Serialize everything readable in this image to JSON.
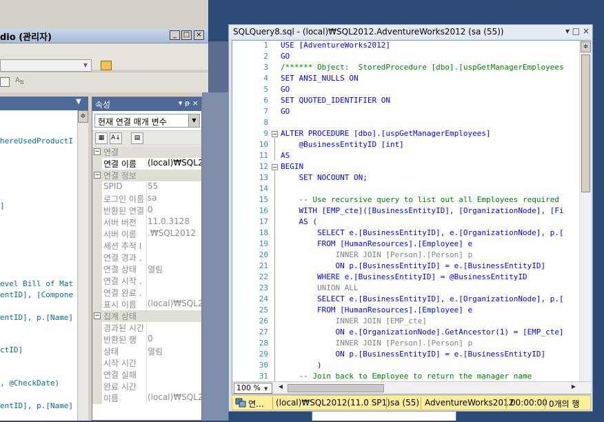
{
  "background_window": {
    "title": "dio (관리자)",
    "controls": [
      "_",
      "□",
      "×"
    ]
  },
  "left_editor_fragments": [
    "hereUsedProductI",
    "]",
    "evel Bill of Mat",
    "entID], [Compone",
    "entID], p.[Name]",
    "ctID]",
    ", @CheckDate)",
    "entID], p.[Name]"
  ],
  "properties": {
    "title": "속성",
    "title_controls": "▾ ᵽ ×",
    "selector_value": "현재 연결 매개 변수",
    "categories": [
      {
        "name": "연결",
        "rows": [
          {
            "name": "연결 이름",
            "value": "(local)₩SQL2",
            "selected": true
          }
        ]
      },
      {
        "name": "연결 정보",
        "rows": [
          {
            "name": "SPID",
            "value": "55"
          },
          {
            "name": "로그인 이름",
            "value": "sa"
          },
          {
            "name": "반환된 연결",
            "value": "0"
          },
          {
            "name": "서버 버전",
            "value": "11.0.3128"
          },
          {
            "name": "서버 이름",
            "value": ".₩SQL2012"
          },
          {
            "name": "세션 추적 I",
            "value": ""
          },
          {
            "name": "연결 경과 .",
            "value": ""
          },
          {
            "name": "연결 상태",
            "value": "열림"
          },
          {
            "name": "연결 시작 .",
            "value": ""
          },
          {
            "name": "연결 완료 .",
            "value": ""
          },
          {
            "name": "표시 이름",
            "value": "(local)₩SQL2"
          }
        ]
      },
      {
        "name": "집계 상태",
        "rows": [
          {
            "name": "경과된 시간",
            "value": ""
          },
          {
            "name": "반환된 행",
            "value": "0"
          },
          {
            "name": "상태",
            "value": "열림"
          },
          {
            "name": "시작 시간",
            "value": ""
          },
          {
            "name": "연결 실패",
            "value": ""
          },
          {
            "name": "완료 시간",
            "value": ""
          },
          {
            "name": "이름",
            "value": "(local)₩SQL2"
          }
        ]
      }
    ]
  },
  "query_window": {
    "title": "SQLQuery8.sql - (local)₩SQL2012.AdventureWorks2012 (sa (55))",
    "controls": "▾ □ ×",
    "zoom": "100 %",
    "lines": [
      {
        "n": "1",
        "text": "USE [AdventureWorks2012]"
      },
      {
        "n": "2",
        "text": "GO"
      },
      {
        "n": "3",
        "text": "/****** Object:  StoredProcedure [dbo].[uspGetManagerEmployees"
      },
      {
        "n": "4",
        "text": "SET ANSI_NULLS ON"
      },
      {
        "n": "5",
        "text": "GO"
      },
      {
        "n": "6",
        "text": "SET QUOTED_IDENTIFIER ON"
      },
      {
        "n": "7",
        "text": "GO"
      },
      {
        "n": "8",
        "text": ""
      },
      {
        "n": "9",
        "text": "ALTER PROCEDURE [dbo].[uspGetManagerEmployees]"
      },
      {
        "n": "10",
        "text": "    @BusinessEntityID [int]"
      },
      {
        "n": "11",
        "text": "AS"
      },
      {
        "n": "12",
        "text": "BEGIN"
      },
      {
        "n": "13",
        "text": "    SET NOCOUNT ON;"
      },
      {
        "n": "14",
        "text": ""
      },
      {
        "n": "15",
        "text": "    -- Use recursive query to list out all Employees required"
      },
      {
        "n": "16",
        "text": "    WITH [EMP_cte]([BusinessEntityID], [OrganizationNode], [Fi"
      },
      {
        "n": "17",
        "text": "    AS ("
      },
      {
        "n": "18",
        "text": "        SELECT e.[BusinessEntityID], e.[OrganizationNode], p.["
      },
      {
        "n": "19",
        "text": "        FROM [HumanResources].[Employee] e"
      },
      {
        "n": "20",
        "text": "            INNER JOIN [Person].[Person] p"
      },
      {
        "n": "21",
        "text": "            ON p.[BusinessEntityID] = e.[BusinessEntityID]"
      },
      {
        "n": "22",
        "text": "        WHERE e.[BusinessEntityID] = @BusinessEntityID"
      },
      {
        "n": "23",
        "text": "        UNION ALL"
      },
      {
        "n": "24",
        "text": "        SELECT e.[BusinessEntityID], e.[OrganizationNode], p.["
      },
      {
        "n": "25",
        "text": "        FROM [HumanResources].[Employee] e"
      },
      {
        "n": "26",
        "text": "            INNER JOIN [EMP_cte]"
      },
      {
        "n": "27",
        "text": "            ON e.[OrganizationNode].GetAncestor(1) = [EMP_cte]"
      },
      {
        "n": "28",
        "text": "            INNER JOIN [Person].[Person] p"
      },
      {
        "n": "29",
        "text": "            ON p.[BusinessEntityID] = e.[BusinessEntityID]"
      },
      {
        "n": "30",
        "text": "        )"
      },
      {
        "n": "31",
        "text": "    -- Join back to Employee to return the manager name"
      }
    ],
    "status": {
      "connection": "연…",
      "server": "(local)₩SQL2012(11.0 SP1)",
      "user": "sa (55)",
      "database": "AdventureWorks2012",
      "elapsed": "00:00:00",
      "rows": "0개의 행"
    }
  },
  "colors": {
    "desktop": "#2b4a75",
    "status_bar": "#ffef9c",
    "keyword": "#0000ff",
    "comment": "#008000",
    "line_number": "#2b91af"
  }
}
